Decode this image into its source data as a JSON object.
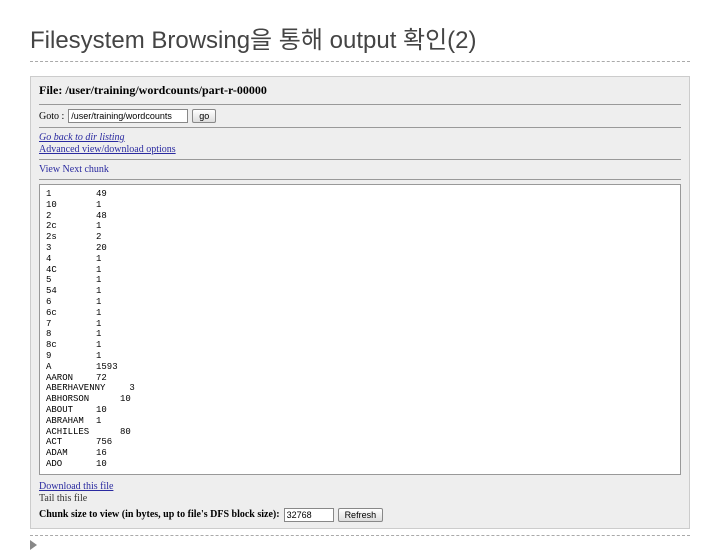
{
  "slide": {
    "title": "Filesystem Browsing을 통해 output 확인(2)"
  },
  "file": {
    "label_prefix": "File: ",
    "path": "/user/training/wordcounts/part-r-00000"
  },
  "goto": {
    "label": "Goto :",
    "value": "/user/training/wordcounts",
    "button": "go"
  },
  "links": {
    "go_back": "Go back to dir listing",
    "advanced": "Advanced view/download options",
    "view_next": "View Next chunk",
    "download": "Download this file",
    "tail": "Tail this file"
  },
  "chunk": {
    "label": "Chunk size to view (in bytes, up to file's DFS block size):",
    "value": "32768",
    "button": "Refresh"
  },
  "listing": [
    {
      "k": "1",
      "v": "49"
    },
    {
      "k": "10",
      "v": "1"
    },
    {
      "k": "2",
      "v": "48"
    },
    {
      "k": "2c",
      "v": "1"
    },
    {
      "k": "2s",
      "v": "2"
    },
    {
      "k": "3",
      "v": "20"
    },
    {
      "k": "4",
      "v": "1"
    },
    {
      "k": "4C",
      "v": "1"
    },
    {
      "k": "5",
      "v": "1"
    },
    {
      "k": "54",
      "v": "1"
    },
    {
      "k": "6",
      "v": "1"
    },
    {
      "k": "6c",
      "v": "1"
    },
    {
      "k": "7",
      "v": "1"
    },
    {
      "k": "8",
      "v": "1"
    },
    {
      "k": "8c",
      "v": "1"
    },
    {
      "k": "9",
      "v": "1"
    },
    {
      "k": "A",
      "v": "1593"
    },
    {
      "k": "AARON",
      "v": "72"
    },
    {
      "k": "ABERHAVENNY",
      "v": "",
      "c3": "3"
    },
    {
      "k": "ABHORSON",
      "v": "",
      "c3": "10"
    },
    {
      "k": "ABOUT",
      "v": "10"
    },
    {
      "k": "ABRAHAM",
      "v": "1"
    },
    {
      "k": "ACHILLES",
      "v": "",
      "c3": "80"
    },
    {
      "k": "ACT",
      "v": "756"
    },
    {
      "k": "ADAM",
      "v": "16"
    },
    {
      "k": "ADO",
      "v": "10"
    }
  ]
}
